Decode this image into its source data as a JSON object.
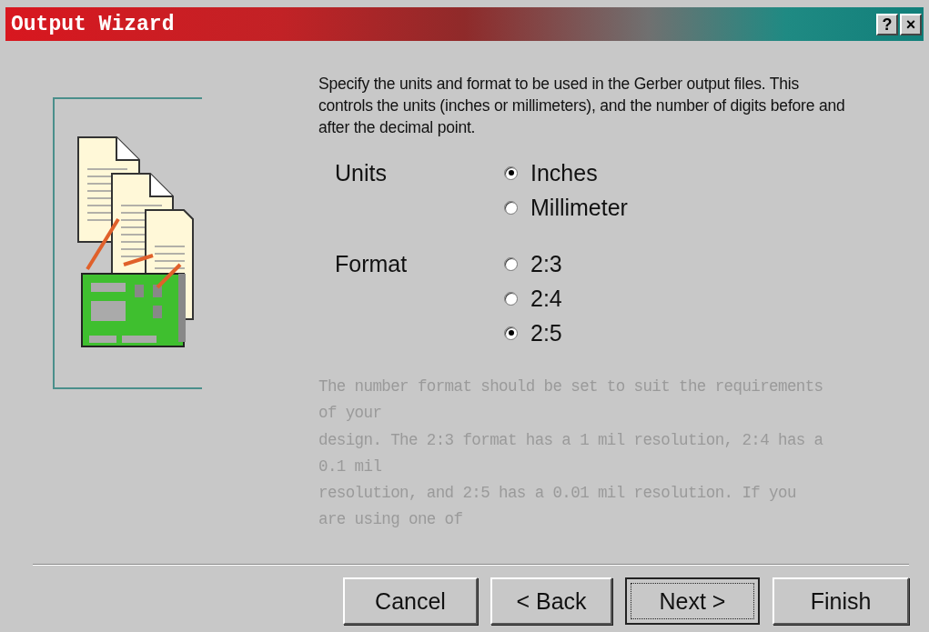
{
  "window": {
    "title": "Output Wizard",
    "title_buttons": [
      "?",
      "×"
    ]
  },
  "intro": "Specify the units and format to be used in the Gerber output files. This controls the units (inches or millimeters), and the number of digits before and after the decimal point.",
  "groups": [
    {
      "label": "Units",
      "options": [
        {
          "label": "Inches",
          "selected": true
        },
        {
          "label": "Millimeter",
          "selected": false
        }
      ]
    },
    {
      "label": "Format",
      "options": [
        {
          "label": "2:3",
          "selected": false
        },
        {
          "label": "2:4",
          "selected": false
        },
        {
          "label": "2:5",
          "selected": true
        }
      ]
    }
  ],
  "note_lines": [
    "The number format should be set to suit the requirements",
    "of your",
    "design. The 2:3 format has a 1 mil resolution, 2:4 has a",
    "0.1 mil",
    "resolution, and 2:5 has a 0.01 mil resolution. If you",
    "are using one of"
  ],
  "buttons": [
    {
      "label": "Cancel",
      "default": false
    },
    {
      "label": "< Back",
      "default": false
    },
    {
      "label": "Next >",
      "default": true
    },
    {
      "label": "Finish",
      "default": false
    }
  ]
}
